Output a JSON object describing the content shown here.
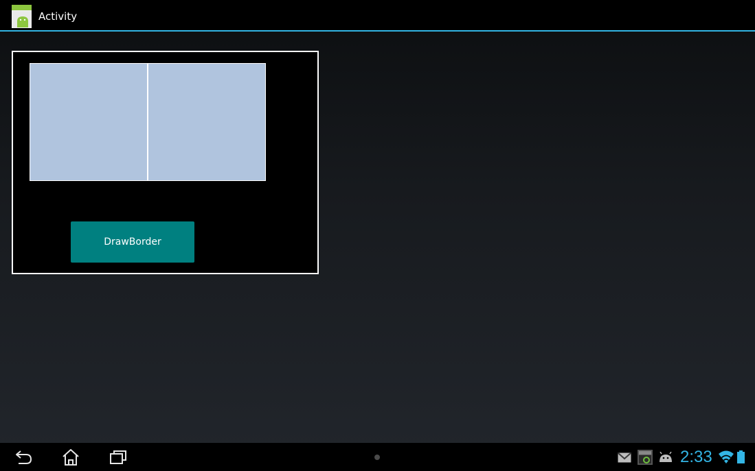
{
  "action_bar": {
    "title": "Activity",
    "app_icon": "android-app-icon"
  },
  "content": {
    "frame_border_color": "#ffffff",
    "panel_color": "#b0c4de",
    "button_label": "DrawBorder",
    "button_color": "#008080"
  },
  "system_bar": {
    "nav_icons": [
      "back-icon",
      "home-icon",
      "recent-apps-icon"
    ],
    "notification_icons": [
      "gmail-icon",
      "sdk-icon",
      "usb-debugging-icon"
    ],
    "clock": "2:33",
    "status_icons": [
      "wifi-icon",
      "battery-icon"
    ],
    "accent_color": "#33b5e5"
  }
}
